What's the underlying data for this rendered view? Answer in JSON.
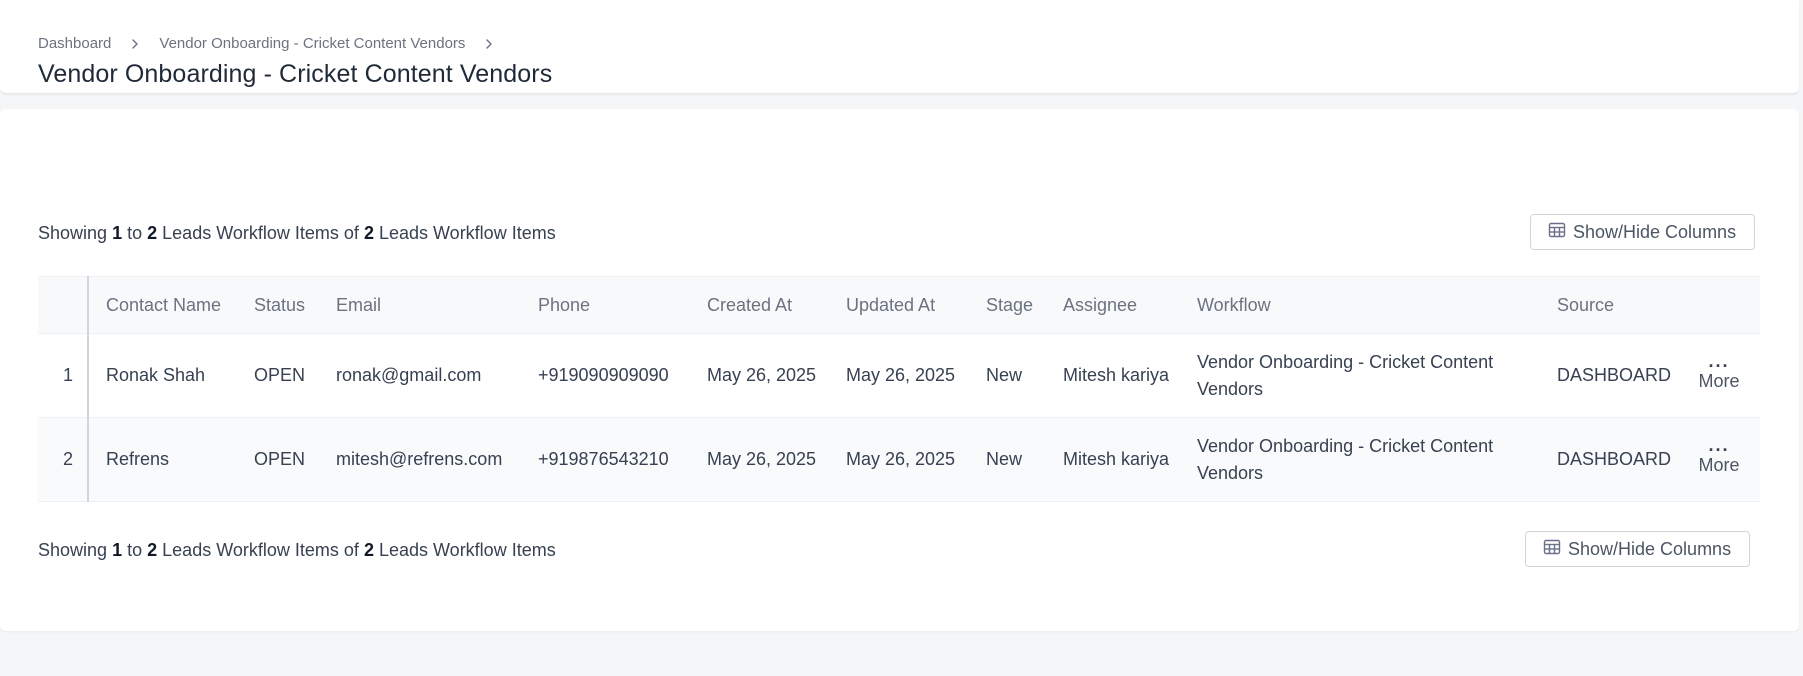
{
  "breadcrumb": {
    "items": [
      "Dashboard",
      "Vendor Onboarding - Cricket Content Vendors"
    ]
  },
  "page": {
    "title": "Vendor Onboarding - Cricket Content Vendors"
  },
  "summary": {
    "prefix": "Showing",
    "from": "1",
    "to_word": "to",
    "to": "2",
    "entity": "Leads Workflow Items",
    "of_word": "of",
    "total": "2",
    "entity_end": "Leads Workflow Items"
  },
  "toolbar": {
    "columns_button": "Show/Hide Columns"
  },
  "table": {
    "headers": [
      "Contact Name",
      "Status",
      "Email",
      "Phone",
      "Created At",
      "Updated At",
      "Stage",
      "Assignee",
      "Workflow",
      "Source"
    ],
    "rows": [
      {
        "index": "1",
        "contact_name": "Ronak Shah",
        "status": "OPEN",
        "email": "ronak@gmail.com",
        "phone": "+919090909090",
        "created_at": "May 26, 2025",
        "updated_at": "May 26, 2025",
        "stage": "New",
        "assignee": "Mitesh kariya",
        "workflow": "Vendor Onboarding - Cricket Content Vendors",
        "source": "DASHBOARD",
        "more_label": "More"
      },
      {
        "index": "2",
        "contact_name": "Refrens",
        "status": "OPEN",
        "email": "mitesh@refrens.com",
        "phone": "+919876543210",
        "created_at": "May 26, 2025",
        "updated_at": "May 26, 2025",
        "stage": "New",
        "assignee": "Mitesh kariya",
        "workflow": "Vendor Onboarding - Cricket Content Vendors",
        "source": "DASHBOARD",
        "more_label": "More"
      }
    ]
  },
  "icons": {
    "breadcrumb_separator": "chevron-right-icon",
    "columns": "table-columns-icon",
    "more": "ellipsis-icon"
  },
  "colors": {
    "background": "#f5f6f8",
    "card": "#ffffff",
    "header_row": "#f8f9fb",
    "text_primary": "#1f2937",
    "text_muted": "#6b7280"
  }
}
